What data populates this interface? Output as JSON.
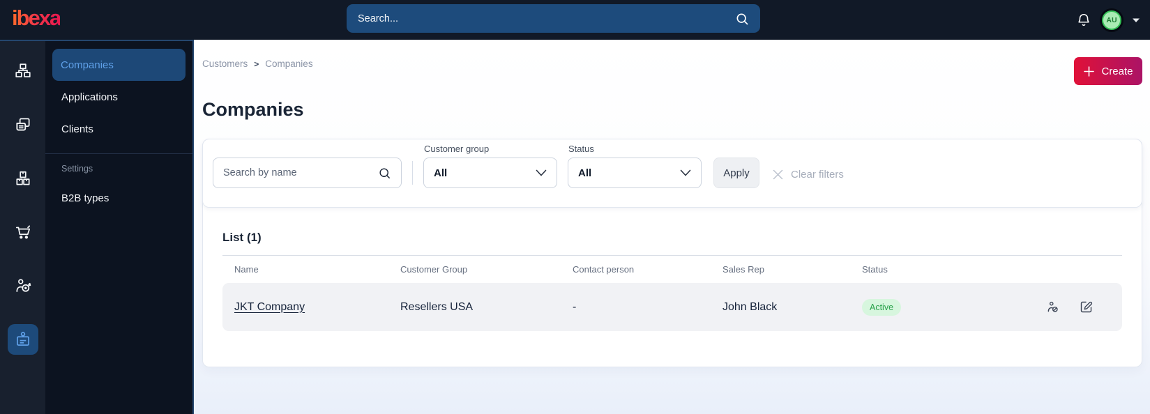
{
  "topbar": {
    "logo_text": "ibexa",
    "search_placeholder": "Search...",
    "avatar_initials": "AU",
    "icons": [
      "search-icon",
      "bell-icon",
      "caret-down-icon"
    ]
  },
  "sidebar": {
    "rail_icons": [
      "sitemap-icon",
      "pages-icon",
      "products-boxes-icon",
      "cart-icon",
      "audience-target-icon",
      "customer-badge-icon"
    ],
    "rail_active": "customer-badge-icon",
    "menu": {
      "items": [
        "Companies",
        "Applications",
        "Clients"
      ],
      "active_item": "Companies",
      "section_label": "Settings",
      "section_items": [
        "B2B types"
      ]
    }
  },
  "breadcrumb": {
    "items": [
      "Customers",
      "Companies"
    ],
    "separator": ">"
  },
  "page": {
    "title": "Companies",
    "create_label": "Create"
  },
  "filters": {
    "search_placeholder": "Search by name",
    "customer_group": {
      "label": "Customer group",
      "value": "All"
    },
    "status": {
      "label": "Status",
      "value": "All"
    },
    "apply_label": "Apply",
    "clear_label": "Clear filters"
  },
  "list": {
    "title": "List (1)",
    "columns": [
      "Name",
      "Customer Group",
      "Contact person",
      "Sales Rep",
      "Status"
    ],
    "rows": [
      {
        "name": "JKT Company",
        "customer_group": "Resellers USA",
        "contact_person": "-",
        "sales_rep": "John Black",
        "status": "Active",
        "actions": [
          "deactivate-user-icon",
          "edit-icon"
        ]
      }
    ]
  },
  "colors": {
    "topbar_bg": "#111927",
    "search_bg": "#1d4b7c",
    "accent_blue": "#5fa0e8",
    "active_pill_bg": "#1d4877",
    "create_gradient_start": "#e01138",
    "create_gradient_end": "#ab1366",
    "badge_bg": "#d7f6de",
    "badge_text": "#2ba24c",
    "row_bg": "#f1f2f5"
  }
}
